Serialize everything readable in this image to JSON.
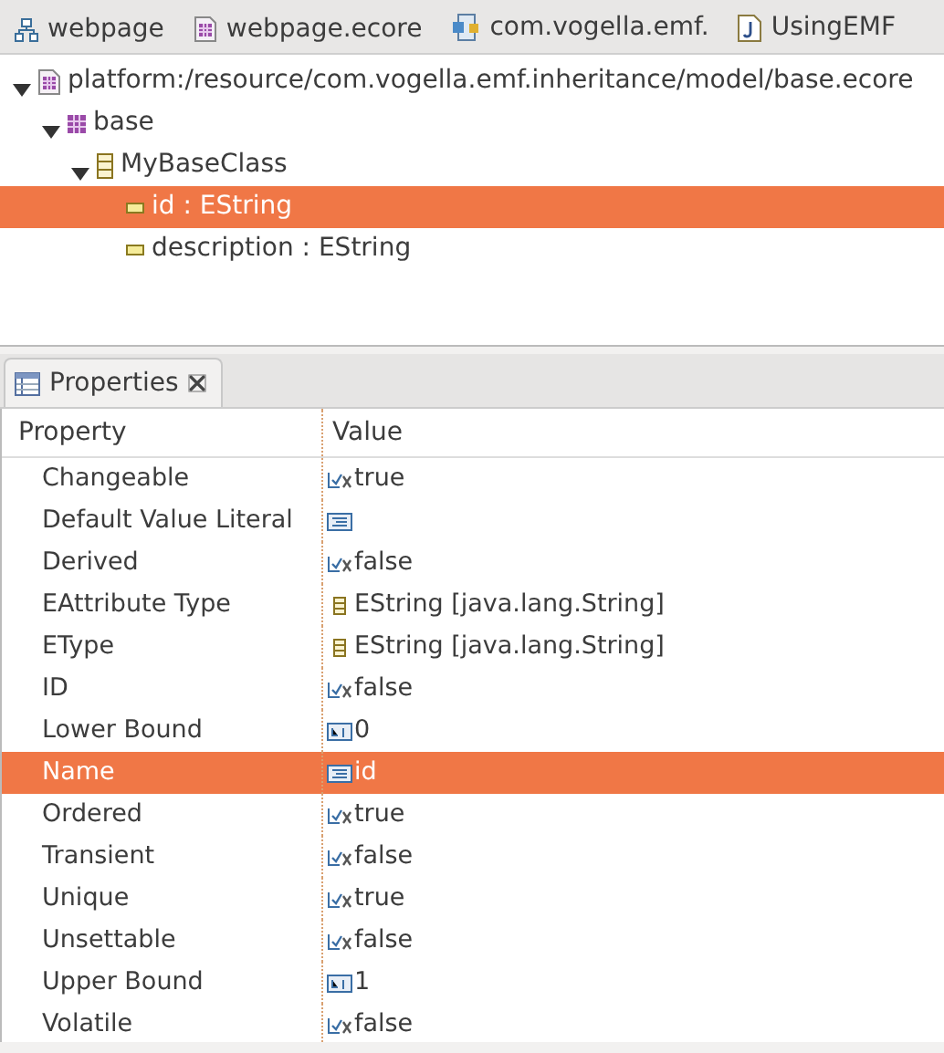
{
  "editor_tabs": [
    {
      "label": "webpage",
      "kind": "diagram"
    },
    {
      "label": "webpage.ecore",
      "kind": "ecore"
    },
    {
      "label": "com.vogella.emf.",
      "kind": "plugin"
    },
    {
      "label": "UsingEMF",
      "kind": "java"
    }
  ],
  "tree": [
    {
      "label": "platform:/resource/com.vogella.emf.inheritance/model/base.ecore",
      "kind": "resource",
      "expanded": true,
      "selected": false,
      "children": [
        {
          "label": "base",
          "kind": "package",
          "expanded": true,
          "selected": false,
          "children": [
            {
              "label": "MyBaseClass",
              "kind": "class",
              "expanded": true,
              "selected": false,
              "children": [
                {
                  "label": "id : EString",
                  "kind": "attribute",
                  "selected": true
                },
                {
                  "label": "description : EString",
                  "kind": "attribute",
                  "selected": false
                }
              ]
            }
          ]
        }
      ]
    }
  ],
  "properties_view": {
    "title": "Properties",
    "columns": [
      "Property",
      "Value"
    ],
    "rows": [
      {
        "property": "Changeable",
        "value": "true",
        "kind": "boolean",
        "selected": false
      },
      {
        "property": "Default Value Literal",
        "value": "",
        "kind": "text",
        "selected": false
      },
      {
        "property": "Derived",
        "value": "false",
        "kind": "boolean",
        "selected": false
      },
      {
        "property": "EAttribute Type",
        "value": "EString [java.lang.String]",
        "kind": "type",
        "selected": false
      },
      {
        "property": "EType",
        "value": "EString [java.lang.String]",
        "kind": "type",
        "selected": false
      },
      {
        "property": "ID",
        "value": "false",
        "kind": "boolean",
        "selected": false
      },
      {
        "property": "Lower Bound",
        "value": "0",
        "kind": "number",
        "selected": false
      },
      {
        "property": "Name",
        "value": "id",
        "kind": "text",
        "selected": true
      },
      {
        "property": "Ordered",
        "value": "true",
        "kind": "boolean",
        "selected": false
      },
      {
        "property": "Transient",
        "value": "false",
        "kind": "boolean",
        "selected": false
      },
      {
        "property": "Unique",
        "value": "true",
        "kind": "boolean",
        "selected": false
      },
      {
        "property": "Unsettable",
        "value": "false",
        "kind": "boolean",
        "selected": false
      },
      {
        "property": "Upper Bound",
        "value": "1",
        "kind": "number",
        "selected": false
      },
      {
        "property": "Volatile",
        "value": "false",
        "kind": "boolean",
        "selected": false
      }
    ]
  }
}
